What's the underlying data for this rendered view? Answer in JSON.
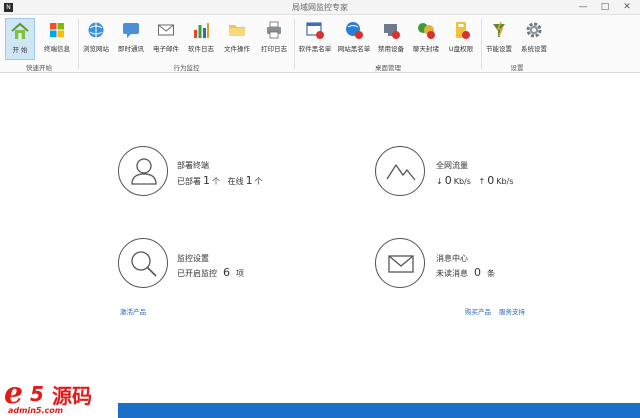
{
  "window": {
    "title": "局域网监控专家",
    "minimize": "—",
    "maximize": "□",
    "close": "✕"
  },
  "ribbon": {
    "items": [
      {
        "label": "开 始",
        "icon": "home-icon"
      },
      {
        "label": "终端信息",
        "icon": "windows-icon"
      },
      {
        "label": "浏览网站",
        "icon": "browser-icon"
      },
      {
        "label": "即时通讯",
        "icon": "chat-icon"
      },
      {
        "label": "电子邮件",
        "icon": "mail-icon"
      },
      {
        "label": "软件日志",
        "icon": "chart-icon"
      },
      {
        "label": "文件操作",
        "icon": "folder-icon"
      },
      {
        "label": "打印日志",
        "icon": "printer-icon"
      },
      {
        "label": "软件黑名单",
        "icon": "app-block-icon"
      },
      {
        "label": "网站黑名单",
        "icon": "web-block-icon"
      },
      {
        "label": "禁用设备",
        "icon": "device-block-icon"
      },
      {
        "label": "聊天封堵",
        "icon": "chat-block-icon"
      },
      {
        "label": "U盘权限",
        "icon": "usb-icon"
      },
      {
        "label": "节能设置",
        "icon": "energy-icon"
      },
      {
        "label": "系统设置",
        "icon": "gear-icon"
      }
    ],
    "groups": [
      "快速开始",
      "行为监控",
      "桌面管理",
      "设置"
    ]
  },
  "dashboard": {
    "deploy": {
      "title": "部署终端",
      "deployed_label": "已部署",
      "deployed_count": "1",
      "deployed_unit": "个",
      "online_label": "在线",
      "online_count": "1",
      "online_unit": "个"
    },
    "traffic": {
      "title": "全网流量",
      "down_arrow": "↓",
      "down_value": "0",
      "down_unit": "Kb/s",
      "up_arrow": "↑",
      "up_value": "0",
      "up_unit": "Kb/s"
    },
    "monitor": {
      "title": "监控设置",
      "enabled_label": "已开启监控",
      "enabled_count": "6",
      "enabled_unit": "项"
    },
    "messages": {
      "title": "消息中心",
      "unread_label": "未读消息",
      "unread_count": "0",
      "unread_unit": "条"
    }
  },
  "links": {
    "activate": "激活产品",
    "buy": "购买产品",
    "support": "服务支持"
  },
  "watermark": {
    "brand_e": "e",
    "brand_5": "5",
    "brand_cn": "源码",
    "url": "admin5.com"
  },
  "colors": {
    "accent": "#1b6fc7",
    "link": "#2a66b6",
    "active_tab": "#cfe6f7",
    "watermark": "#e21a1a"
  }
}
